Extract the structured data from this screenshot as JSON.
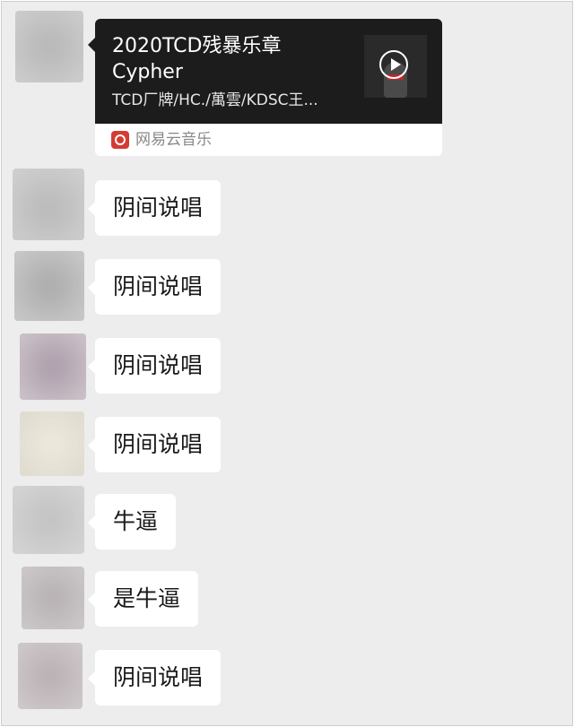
{
  "music_card": {
    "title": "2020TCD残暴乐章\nCypher",
    "artists": "TCD厂牌/HC./萬雲/KDSC王...",
    "source": "网易云音乐",
    "cover_icon": "play-icon"
  },
  "messages": [
    {
      "text": "阴间说唱"
    },
    {
      "text": "阴间说唱"
    },
    {
      "text": "阴间说唱"
    },
    {
      "text": "阴间说唱"
    },
    {
      "text": "牛逼"
    },
    {
      "text": "是牛逼"
    },
    {
      "text": "阴间说唱"
    }
  ],
  "colors": {
    "chat_background": "#ededed",
    "bubble": "#ffffff",
    "card_dark": "#1c1c1c",
    "netease_red": "#d43c33"
  }
}
